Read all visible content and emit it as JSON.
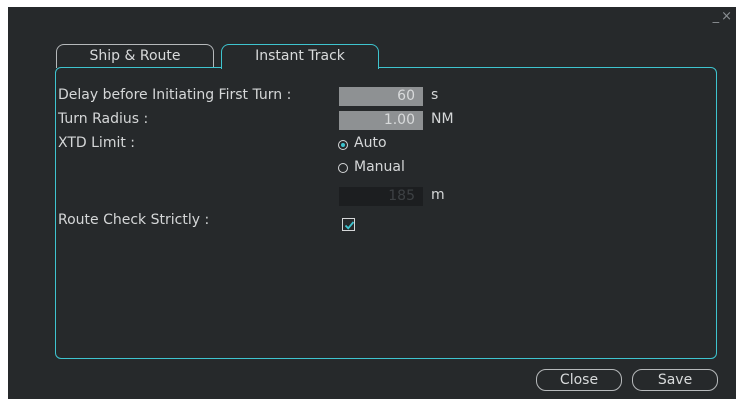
{
  "window": {
    "minimize": "_",
    "close": "×"
  },
  "tabs": [
    {
      "label": "Ship & Route",
      "active": false
    },
    {
      "label": "Instant Track",
      "active": true
    }
  ],
  "form": {
    "delay_label": "Delay before Initiating First Turn :",
    "delay_value": "60",
    "delay_unit": "s",
    "turn_radius_label": "Turn Radius :",
    "turn_radius_value": "1.00",
    "turn_radius_unit": "NM",
    "xtd_label": "XTD Limit :",
    "xtd_options": [
      {
        "label": "Auto",
        "selected": true
      },
      {
        "label": "Manual",
        "selected": false
      }
    ],
    "xtd_manual_value": "185",
    "xtd_manual_unit": "m",
    "route_check_label": "Route Check Strictly :",
    "route_check_checked": true
  },
  "buttons": {
    "close": "Close",
    "save": "Save"
  },
  "colors": {
    "accent": "#3ec4cf",
    "background": "#26292b"
  }
}
